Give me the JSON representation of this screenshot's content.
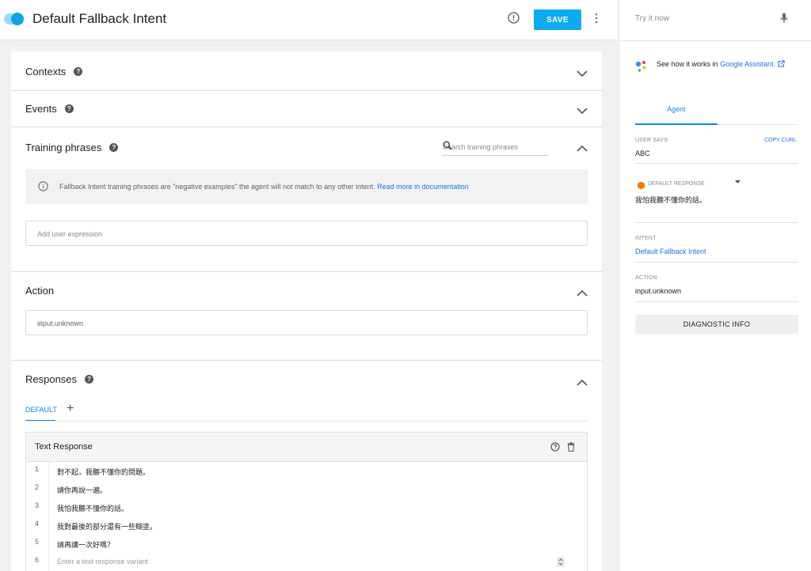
{
  "header": {
    "intent_name": "Default Fallback Intent",
    "save_label": "SAVE"
  },
  "sections": {
    "contexts": "Contexts",
    "events": "Events",
    "training_phrases": "Training phrases",
    "action": "Action",
    "responses": "Responses"
  },
  "training": {
    "search_placeholder": "Search training phrases",
    "info_text": "Fallback Intent training phrases are \"negative examples\" the agent will not match to any other intent.",
    "info_link": "Read more in documentation",
    "add_placeholder": "Add user expression"
  },
  "action": {
    "value": "input.unknown"
  },
  "responses": {
    "tab_default": "DEFAULT",
    "tab_add": "+",
    "card_title": "Text Response",
    "rows": [
      {
        "num": "1",
        "text": "對不起，我聽不懂你的問題。"
      },
      {
        "num": "2",
        "text": "請你再說一遍。"
      },
      {
        "num": "3",
        "text": "我怕我聽不懂你的話。"
      },
      {
        "num": "4",
        "text": "我對最後的部分還有一些糊塗。"
      },
      {
        "num": "5",
        "text": "請再講一次好嗎？"
      }
    ],
    "placeholder_row": {
      "num": "6",
      "text": "Enter a text response variant"
    }
  },
  "right_panel": {
    "try_it_now": "Try it now",
    "see_how": "See how it works in",
    "google_assistant": "Google Assistant.",
    "agent_tab": "Agent",
    "user_says_label": "USER SAYS",
    "copy_curl": "COPY CURL",
    "user_says_value": "ABC",
    "default_response_label": "DEFAULT RESPONSE",
    "default_response_value": "我怕我聽不懂你的話。",
    "intent_label": "INTENT",
    "intent_value": "Default Fallback Intent",
    "action_label": "ACTION",
    "action_value": "input.unknown",
    "diagnostic_label": "DIAGNOSTIC INFO"
  },
  "colors": {
    "accent": "#0eaaf0",
    "link": "#1a73e8",
    "tab_blue": "#0c8bd6"
  }
}
